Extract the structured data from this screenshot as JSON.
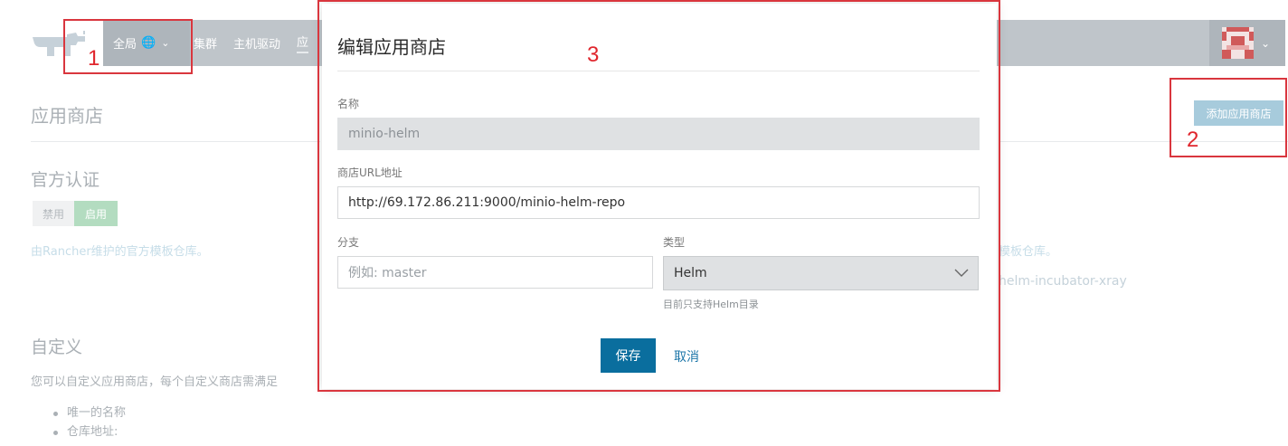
{
  "nav": {
    "scope_label": "全局",
    "links": [
      "集群",
      "主机驱动",
      "应"
    ],
    "icons": {
      "globe": "globe-icon",
      "chevron": "chevron-down-icon",
      "logo": "rancher-logo"
    }
  },
  "page": {
    "title": "应用商店",
    "add_button": "添加应用商店",
    "official": {
      "heading": "官方认证",
      "toggle_disable": "禁用",
      "toggle_enable": "启用",
      "left_link": "由Rancher维护的官方模板仓库。",
      "right_link": "模板仓库。",
      "right_text": "helm-incubator-xray"
    },
    "custom": {
      "heading": "自定义",
      "description": "您可以自定义应用商店，每个自定义商店需满足",
      "items": [
        "唯一的名称",
        "仓库地址:"
      ]
    }
  },
  "modal": {
    "title": "编辑应用商店",
    "name_label": "名称",
    "name_value": "minio-helm",
    "url_label": "商店URL地址",
    "url_value": "http://69.172.86.211:9000/minio-helm-repo",
    "branch_label": "分支",
    "branch_placeholder": "例如: master",
    "type_label": "类型",
    "type_value": "Helm",
    "type_help": "目前只支持Helm目录",
    "save_label": "保存",
    "cancel_label": "取消"
  },
  "annotations": [
    "1",
    "2",
    "3"
  ],
  "colors": {
    "accent": "#0a6e9e",
    "annotation": "#d9363e",
    "toggle_enabled": "#b3dcc0"
  }
}
